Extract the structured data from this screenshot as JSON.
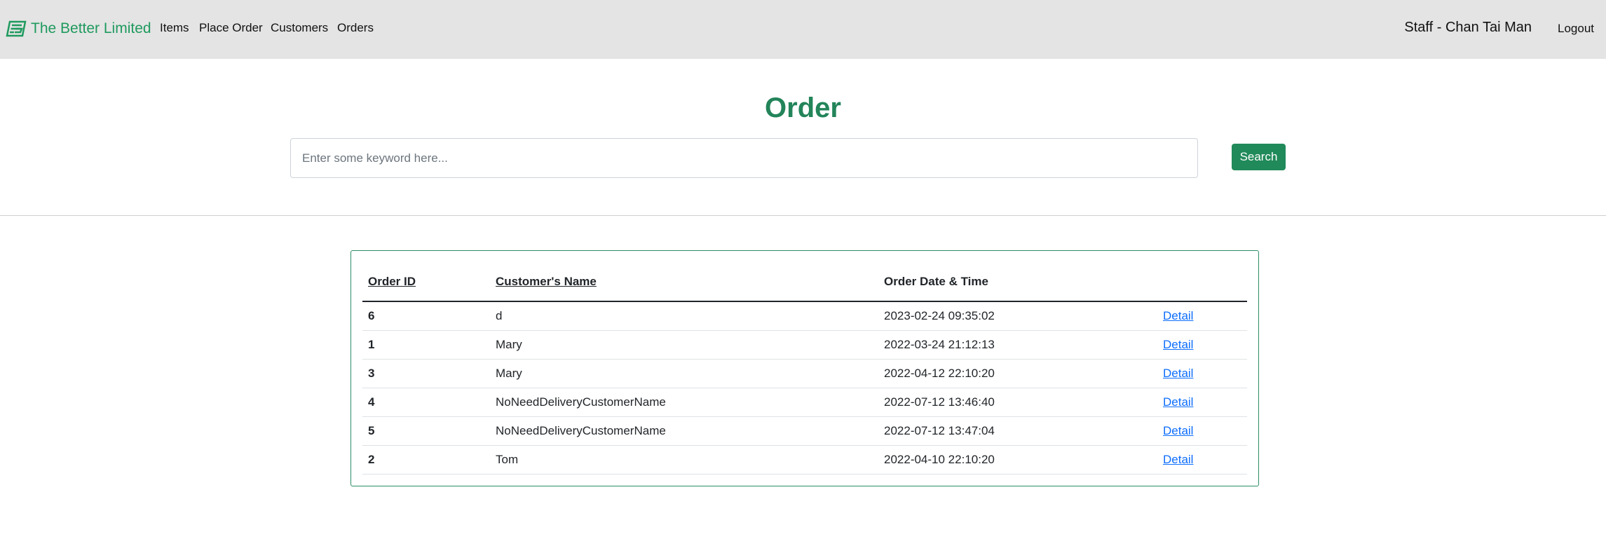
{
  "navbar": {
    "brand": "The Better Limited",
    "links": [
      "Items",
      "Place Order",
      "Customers",
      "Orders"
    ],
    "staff": "Staff - Chan Tai Man",
    "logout": "Logout"
  },
  "page": {
    "title": "Order"
  },
  "search": {
    "placeholder": "Enter some keyword here...",
    "button": "Search"
  },
  "table": {
    "headers": [
      "Order ID",
      "Customer's Name",
      "Order Date & Time",
      ""
    ],
    "rows": [
      {
        "id": "6",
        "name": "d",
        "date": "2023-02-24 09:35:02",
        "action": "Detail"
      },
      {
        "id": "1",
        "name": "Mary",
        "date": "2022-03-24 21:12:13",
        "action": "Detail"
      },
      {
        "id": "3",
        "name": "Mary",
        "date": "2022-04-12 22:10:20",
        "action": "Detail"
      },
      {
        "id": "4",
        "name": "NoNeedDeliveryCustomerName",
        "date": "2022-07-12 13:46:40",
        "action": "Detail"
      },
      {
        "id": "5",
        "name": "NoNeedDeliveryCustomerName",
        "date": "2022-07-12 13:47:04",
        "action": "Detail"
      },
      {
        "id": "2",
        "name": "Tom",
        "date": "2022-04-10 22:10:20",
        "action": "Detail"
      }
    ]
  },
  "colors": {
    "brand": "#1f9a5e",
    "title": "#23845a",
    "button": "#218a5a",
    "link": "#0d6efd",
    "navbar_bg": "#e4e4e4"
  },
  "icons": {
    "brand_logo": "brand-logo-icon"
  }
}
